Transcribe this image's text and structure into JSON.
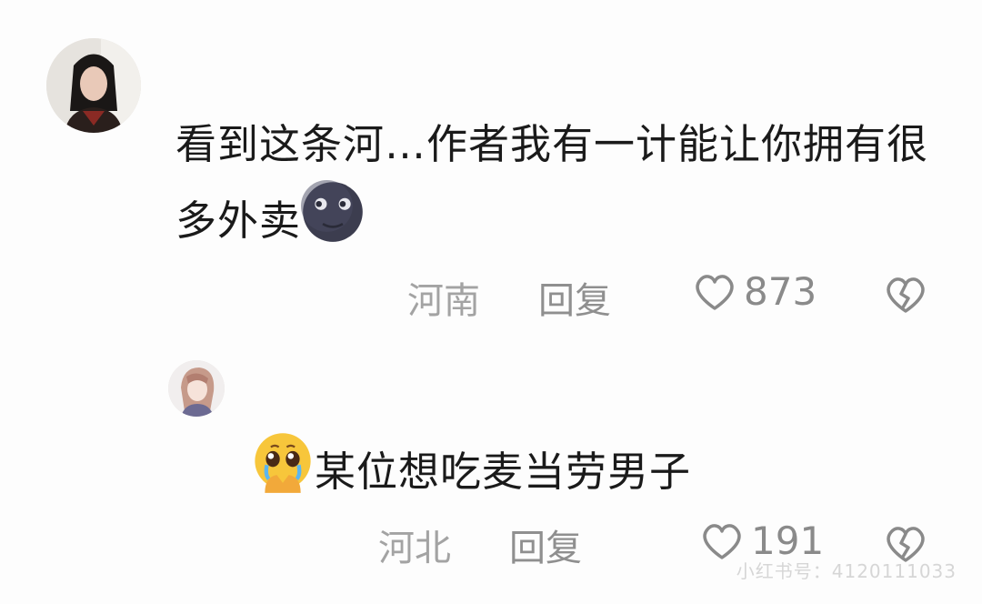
{
  "comments": [
    {
      "text_main": "看到这条河…作者我有一计能让你拥有很多外卖",
      "emoji": "new-moon-face-icon",
      "region": "河南",
      "reply_label": "回复",
      "likes": "873"
    },
    {
      "emoji": "pleading-face-icon",
      "text_main": "某位想吃麦当劳男子",
      "region": "河北",
      "reply_label": "回复",
      "likes": "191"
    }
  ],
  "watermark": "小红书号：4120111033",
  "colors": {
    "background": "#fdfdfd",
    "text": "#1a1a1a",
    "meta": "#a3a3a3"
  }
}
